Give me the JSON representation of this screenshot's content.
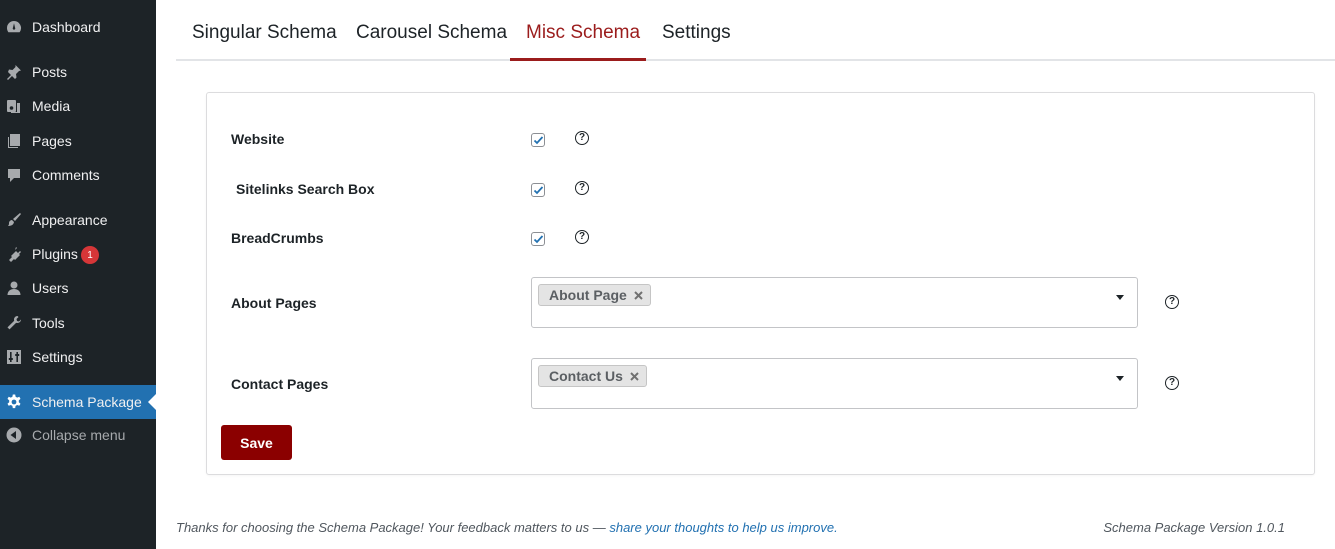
{
  "sidebar": {
    "items": [
      {
        "label": "Dashboard",
        "icon": "dashboard-icon"
      },
      {
        "label": "Posts",
        "icon": "pin-icon"
      },
      {
        "label": "Media",
        "icon": "media-icon"
      },
      {
        "label": "Pages",
        "icon": "pages-icon"
      },
      {
        "label": "Comments",
        "icon": "comment-icon"
      },
      {
        "label": "Appearance",
        "icon": "brush-icon"
      },
      {
        "label": "Plugins",
        "icon": "plugin-icon",
        "badge": "1"
      },
      {
        "label": "Users",
        "icon": "user-icon"
      },
      {
        "label": "Tools",
        "icon": "wrench-icon"
      },
      {
        "label": "Settings",
        "icon": "settings-sliders-icon"
      },
      {
        "label": "Schema Package",
        "icon": "gear-icon",
        "active": true
      },
      {
        "label": "Collapse menu",
        "icon": "collapse-icon"
      }
    ],
    "colors": {
      "bg": "#1d2327",
      "active": "#2271b1",
      "badge": "#d63638"
    }
  },
  "tabs": [
    {
      "label": "Singular Schema"
    },
    {
      "label": "Carousel Schema"
    },
    {
      "label": "Misc Schema",
      "active": true
    },
    {
      "label": "Settings"
    }
  ],
  "form": {
    "website": {
      "label": "Website",
      "checked": true
    },
    "sitelinks": {
      "label": "Sitelinks Search Box",
      "checked": true
    },
    "breadcrumbs": {
      "label": "BreadCrumbs",
      "checked": true
    },
    "about_pages": {
      "label": "About Pages",
      "selected": "About Page"
    },
    "contact_pages": {
      "label": "Contact Pages",
      "selected": "Contact Us"
    },
    "help_glyph": "?",
    "save_label": "Save"
  },
  "footer": {
    "thanks_text": "Thanks for choosing the Schema Package! Your feedback matters to us — ",
    "link_text": "share your thoughts to help us improve.",
    "period": "",
    "version": "Schema Package Version 1.0.1"
  },
  "colors": {
    "accent": "#9b1c1c",
    "save_button": "#8b0000",
    "link": "#2271b1",
    "checkmark": "#2271b1"
  }
}
